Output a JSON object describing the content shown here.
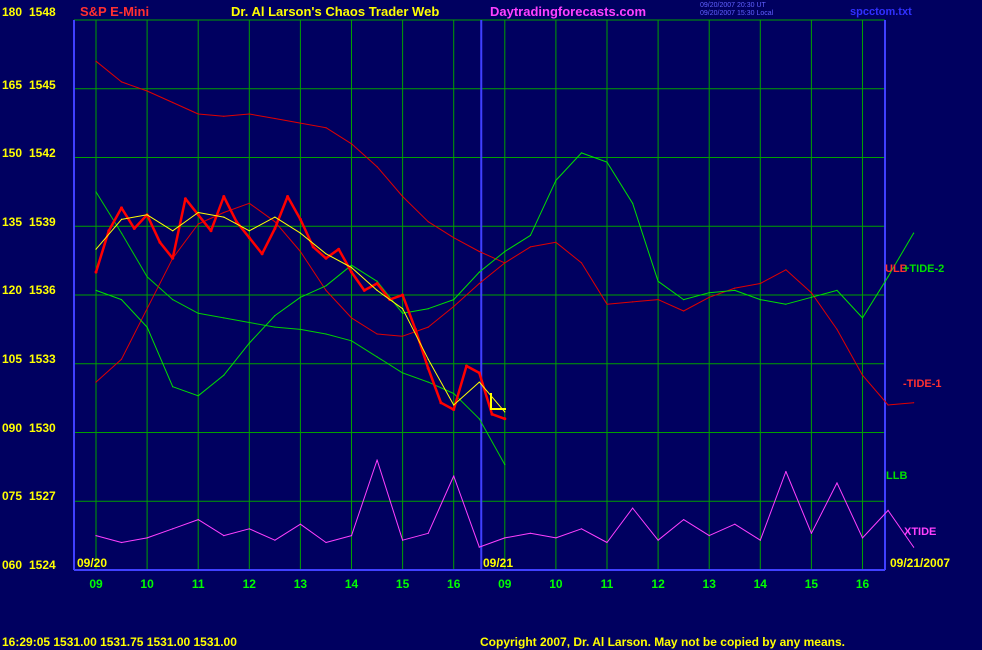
{
  "header": {
    "symbol": "S&P E-Mini",
    "title": "Dr. Al Larson's Chaos Trader Web",
    "site": "Daytradingforecasts.com",
    "stamp_line1": "09/20/2007 20:30 UT",
    "stamp_line2": "09/20/2007 15:30 Local",
    "file": "spcctom.txt"
  },
  "colors": {
    "background": "#000060",
    "grid": "#00a000",
    "axis": "#4040ff",
    "price": "#ff0000",
    "price_high": "#ffffff",
    "average": "#ffff00",
    "tide1": "#e00000",
    "tide2": "#00e000",
    "llb": "#00d000",
    "xtide": "#ff40ff",
    "title": "#ffff00",
    "symbol": "#ff3030",
    "site": "#ff40ff"
  },
  "chart_data": {
    "type": "line",
    "title": "Dr. Al Larson's Chaos Trader Web",
    "y_axis": {
      "ticks": [
        {
          "osc": "180",
          "price": "1548"
        },
        {
          "osc": "165",
          "price": "1545"
        },
        {
          "osc": "150",
          "price": "1542"
        },
        {
          "osc": "135",
          "price": "1539"
        },
        {
          "osc": "120",
          "price": "1536"
        },
        {
          "osc": "105",
          "price": "1533"
        },
        {
          "osc": "090",
          "price": "1530"
        },
        {
          "osc": "075",
          "price": "1527"
        },
        {
          "osc": "060",
          "price": "1524"
        }
      ],
      "range": [
        1524,
        1548
      ]
    },
    "x_axis": {
      "ticks": [
        "09",
        "10",
        "11",
        "12",
        "13",
        "14",
        "15",
        "16",
        "09",
        "10",
        "11",
        "12",
        "13",
        "14",
        "15",
        "16"
      ],
      "range_hours": [
        0,
        16
      ],
      "date_start": "09/20",
      "date_mid": "09/21",
      "date_end": "09/21/2007"
    },
    "series": [
      {
        "name": "ULB",
        "color": "#e00000",
        "x": [
          0,
          0.5,
          1,
          1.5,
          2,
          2.5,
          3,
          3.5,
          4,
          4.5,
          5,
          5.5,
          6,
          6.5,
          7,
          7.5,
          8
        ],
        "y": [
          1546.2,
          1545.3,
          1544.9,
          1544.4,
          1543.9,
          1543.8,
          1543.9,
          1543.7,
          1543.5,
          1543.3,
          1542.6,
          1541.6,
          1540.3,
          1539.2,
          1538.5,
          1537.9,
          1537.4
        ]
      },
      {
        "name": "LLB",
        "color": "#00d000",
        "x": [
          0,
          0.5,
          1,
          1.5,
          2,
          2.5,
          3,
          3.5,
          4,
          4.5,
          5,
          5.5,
          6,
          6.5,
          7,
          7.5,
          8
        ],
        "y": [
          1540.5,
          1538.7,
          1536.8,
          1535.8,
          1535.2,
          1535.0,
          1534.8,
          1534.6,
          1534.5,
          1534.3,
          1534.0,
          1533.3,
          1532.6,
          1532.2,
          1531.7,
          1530.6,
          1528.6
        ]
      },
      {
        "name": "TIDE-1",
        "color": "#e00000",
        "x": [
          0,
          0.5,
          1,
          1.5,
          2,
          2.5,
          3,
          3.5,
          4,
          4.5,
          5,
          5.5,
          6,
          6.5,
          7,
          7.5,
          8,
          8.5,
          9,
          9.5,
          10,
          10.5,
          11,
          11.5,
          12,
          12.5,
          13,
          13.5,
          14,
          14.5,
          15,
          15.5,
          16
        ],
        "y": [
          1532.2,
          1533.2,
          1535.4,
          1537.6,
          1539.1,
          1539.6,
          1540.0,
          1539.2,
          1537.9,
          1536.2,
          1535.0,
          1534.3,
          1534.2,
          1534.6,
          1535.5,
          1536.5,
          1537.4,
          1538.1,
          1538.3,
          1537.4,
          1535.6,
          1535.7,
          1535.8,
          1535.3,
          1535.9,
          1536.3,
          1536.5,
          1537.1,
          1536.1,
          1534.5,
          1532.5,
          1531.2,
          1531.3
        ]
      },
      {
        "name": "TIDE-2",
        "color": "#00e000",
        "x": [
          0,
          0.5,
          1,
          1.5,
          2,
          2.5,
          3,
          3.5,
          4,
          4.5,
          5,
          5.5,
          6,
          6.5,
          7,
          7.5,
          8,
          8.5,
          9,
          9.5,
          10,
          10.5,
          11,
          11.5,
          12,
          12.5,
          13,
          13.5,
          14,
          14.5,
          15,
          15.5,
          16
        ],
        "y": [
          1536.2,
          1535.8,
          1534.6,
          1532.0,
          1531.6,
          1532.5,
          1533.9,
          1535.1,
          1535.9,
          1536.4,
          1537.3,
          1536.6,
          1535.2,
          1535.4,
          1535.8,
          1537.0,
          1537.9,
          1538.6,
          1541.0,
          1542.2,
          1541.8,
          1540.0,
          1536.6,
          1535.8,
          1536.1,
          1536.2,
          1535.8,
          1535.6,
          1535.9,
          1536.2,
          1535.0,
          1536.8,
          1538.7
        ]
      },
      {
        "name": "Price",
        "color": "#ff0000",
        "x": [
          0,
          0.25,
          0.5,
          0.75,
          1,
          1.25,
          1.5,
          1.75,
          2,
          2.25,
          2.5,
          2.75,
          3,
          3.25,
          3.5,
          3.75,
          4,
          4.25,
          4.5,
          4.75,
          5,
          5.25,
          5.5,
          5.75,
          6,
          6.25,
          6.5,
          6.75,
          7,
          7.25,
          7.5,
          7.75,
          8
        ],
        "y": [
          1537.0,
          1538.8,
          1539.8,
          1538.9,
          1539.5,
          1538.3,
          1537.6,
          1540.2,
          1539.5,
          1538.8,
          1540.3,
          1539.2,
          1538.5,
          1537.8,
          1538.9,
          1540.3,
          1539.3,
          1538.1,
          1537.6,
          1538.0,
          1537.0,
          1536.2,
          1536.5,
          1535.8,
          1536.0,
          1534.5,
          1532.8,
          1531.3,
          1531.0,
          1532.9,
          1532.6,
          1530.8,
          1530.6
        ]
      },
      {
        "name": "XTIDE",
        "color": "#ff40ff",
        "x": [
          0,
          0.5,
          1,
          1.5,
          2,
          2.5,
          3,
          3.5,
          4,
          4.5,
          5,
          5.5,
          6,
          6.5,
          7,
          7.5,
          8,
          8.5,
          9,
          9.5,
          10,
          10.5,
          11,
          11.5,
          12,
          12.5,
          13,
          13.5,
          14,
          14.5,
          15,
          15.5,
          16
        ],
        "y": [
          1525.5,
          1525.2,
          1525.4,
          1525.8,
          1526.2,
          1525.5,
          1525.8,
          1525.3,
          1526.0,
          1525.2,
          1525.5,
          1528.8,
          1525.3,
          1525.6,
          1528.1,
          1525.0,
          1525.4,
          1525.6,
          1525.4,
          1525.8,
          1525.2,
          1526.7,
          1525.3,
          1526.2,
          1525.5,
          1526.0,
          1525.3,
          1528.3,
          1525.6,
          1527.8,
          1525.4,
          1526.6,
          1525.0
        ]
      },
      {
        "name": "Average",
        "color": "#ffff00",
        "x": [
          0,
          0.5,
          1,
          1.5,
          2,
          2.5,
          3,
          3.5,
          4,
          4.5,
          5,
          5.5,
          6,
          6.5,
          7,
          7.5,
          8
        ],
        "y": [
          1538.0,
          1539.3,
          1539.5,
          1538.8,
          1539.6,
          1539.4,
          1538.8,
          1539.4,
          1538.7,
          1537.8,
          1537.2,
          1536.2,
          1535.4,
          1533.2,
          1531.2,
          1532.2,
          1530.9
        ]
      }
    ],
    "labels": {
      "ulb": "ULB",
      "tide2": "+TIDE-2",
      "tide1": "-TIDE-1",
      "llb": "LLB",
      "xtide": "XTIDE"
    },
    "grid": true
  },
  "footer": {
    "quote": "16:29:05  1531.00  1531.75  1531.00  1531.00",
    "copyright": "Copyright 2007, Dr. Al Larson. May not be copied by any means."
  }
}
